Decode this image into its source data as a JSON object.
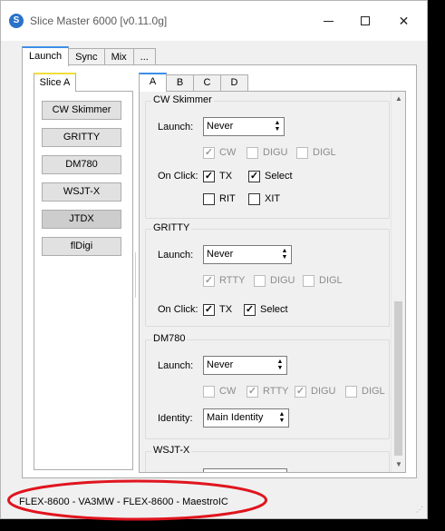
{
  "window": {
    "title": "Slice Master 6000 [v0.11.0g]",
    "app_icon_glyph": "S",
    "controls": {
      "minimize": "minimize-icon",
      "maximize": "maximize-icon",
      "close": "✕"
    }
  },
  "outer_tabs": [
    {
      "label": "Launch",
      "active": true
    },
    {
      "label": "Sync",
      "active": false
    },
    {
      "label": "Mix",
      "active": false
    },
    {
      "label": "...",
      "active": false
    }
  ],
  "slice_tab": {
    "label": "Slice A",
    "accent": "#f0de3a"
  },
  "launch_buttons": [
    {
      "label": "CW Skimmer",
      "pressed": false
    },
    {
      "label": "GRITTY",
      "pressed": false
    },
    {
      "label": "DM780",
      "pressed": false
    },
    {
      "label": "WSJT-X",
      "pressed": false
    },
    {
      "label": "JTDX",
      "pressed": true
    },
    {
      "label": "flDigi",
      "pressed": false
    }
  ],
  "inner_tabs": [
    {
      "label": "A",
      "active": true
    },
    {
      "label": "B",
      "active": false
    },
    {
      "label": "C",
      "active": false
    },
    {
      "label": "D",
      "active": false
    }
  ],
  "groups": {
    "cw_skimmer": {
      "title": "CW Skimmer",
      "launch_label": "Launch:",
      "launch_value": "Never",
      "modes": [
        {
          "label": "CW",
          "checked": true,
          "enabled": false
        },
        {
          "label": "DIGU",
          "checked": false,
          "enabled": false
        },
        {
          "label": "DIGL",
          "checked": false,
          "enabled": false
        }
      ],
      "onclick_label": "On Click:",
      "onclick": [
        {
          "label": "TX",
          "checked": true
        },
        {
          "label": "Select",
          "checked": true
        },
        {
          "label": "RIT",
          "checked": false
        },
        {
          "label": "XIT",
          "checked": false
        }
      ]
    },
    "gritty": {
      "title": "GRITTY",
      "launch_label": "Launch:",
      "launch_value": "Never",
      "modes": [
        {
          "label": "RTTY",
          "checked": true,
          "enabled": false
        },
        {
          "label": "DIGU",
          "checked": false,
          "enabled": false
        },
        {
          "label": "DIGL",
          "checked": false,
          "enabled": false
        }
      ],
      "onclick_label": "On Click:",
      "onclick": [
        {
          "label": "TX",
          "checked": true
        },
        {
          "label": "Select",
          "checked": true
        }
      ]
    },
    "dm780": {
      "title": "DM780",
      "launch_label": "Launch:",
      "launch_value": "Never",
      "modes": [
        {
          "label": "CW",
          "checked": false,
          "enabled": false
        },
        {
          "label": "RTTY",
          "checked": true,
          "enabled": false
        },
        {
          "label": "DIGU",
          "checked": true,
          "enabled": false
        },
        {
          "label": "DIGL",
          "checked": false,
          "enabled": false
        }
      ],
      "identity_label": "Identity:",
      "identity_value": "Main Identity"
    },
    "wsjtx": {
      "title": "WSJT-X"
    }
  },
  "status": {
    "text": "FLEX-8600 - VA3MW - FLEX-8600 - MaestroIC"
  },
  "colors": {
    "annotation": "#e0141e",
    "tab_accent": "#3c8ee6"
  }
}
